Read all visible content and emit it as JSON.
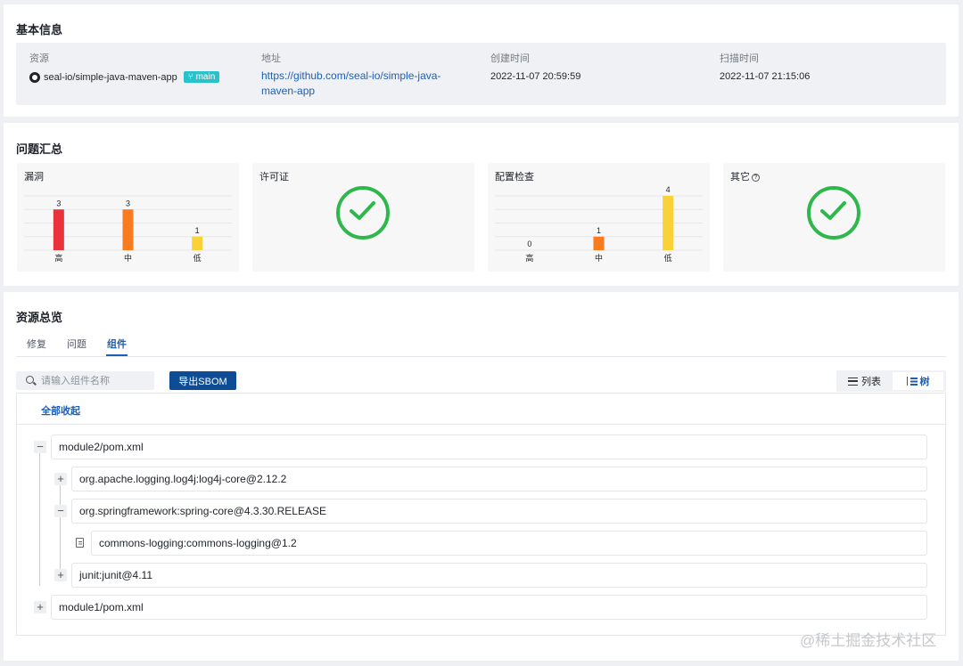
{
  "basic": {
    "title": "基本信息",
    "resource_label": "资源",
    "resource_value": "seal-io/simple-java-maven-app",
    "branch": "main",
    "address_label": "地址",
    "address_value": "https://github.com/seal-io/simple-java-maven-app",
    "created_label": "创建时间",
    "created_value": "2022-11-07 20:59:59",
    "scanned_label": "扫描时间",
    "scanned_value": "2022-11-07 21:15:06"
  },
  "summary": {
    "title": "问题汇总",
    "vuln": {
      "title": "漏洞"
    },
    "license": {
      "title": "许可证"
    },
    "config": {
      "title": "配置检查"
    },
    "other": {
      "title": "其它",
      "help": "?"
    }
  },
  "chart_data": [
    {
      "type": "bar",
      "title": "漏洞",
      "categories": [
        "高",
        "中",
        "低"
      ],
      "values": [
        3,
        3,
        1
      ],
      "colors": [
        "#e8323c",
        "#f97a1f",
        "#fbd13a"
      ],
      "ylim": [
        0,
        4
      ],
      "grid": true
    },
    {
      "type": "bar",
      "title": "配置检查",
      "categories": [
        "高",
        "中",
        "低"
      ],
      "values": [
        0,
        1,
        4
      ],
      "colors": [
        "#e8323c",
        "#f97a1f",
        "#fbd13a"
      ],
      "ylim": [
        0,
        4
      ],
      "grid": true
    }
  ],
  "overview": {
    "title": "资源总览",
    "tabs": [
      {
        "label": "修复"
      },
      {
        "label": "问题"
      },
      {
        "label": "组件"
      }
    ],
    "search_placeholder": "请输入组件名称",
    "export_label": "导出SBOM",
    "view_list": "列表",
    "view_tree": "树",
    "collapse_all": "全部收起",
    "tree": {
      "root1": "module2/pom.xml",
      "child1": "org.apache.logging.log4j:log4j-core@2.12.2",
      "child2": "org.springframework:spring-core@4.3.30.RELEASE",
      "grandchild1": "commons-logging:commons-logging@1.2",
      "child3": "junit:junit@4.11",
      "root2": "module1/pom.xml"
    }
  },
  "watermark": "@稀土掘金技术社区"
}
